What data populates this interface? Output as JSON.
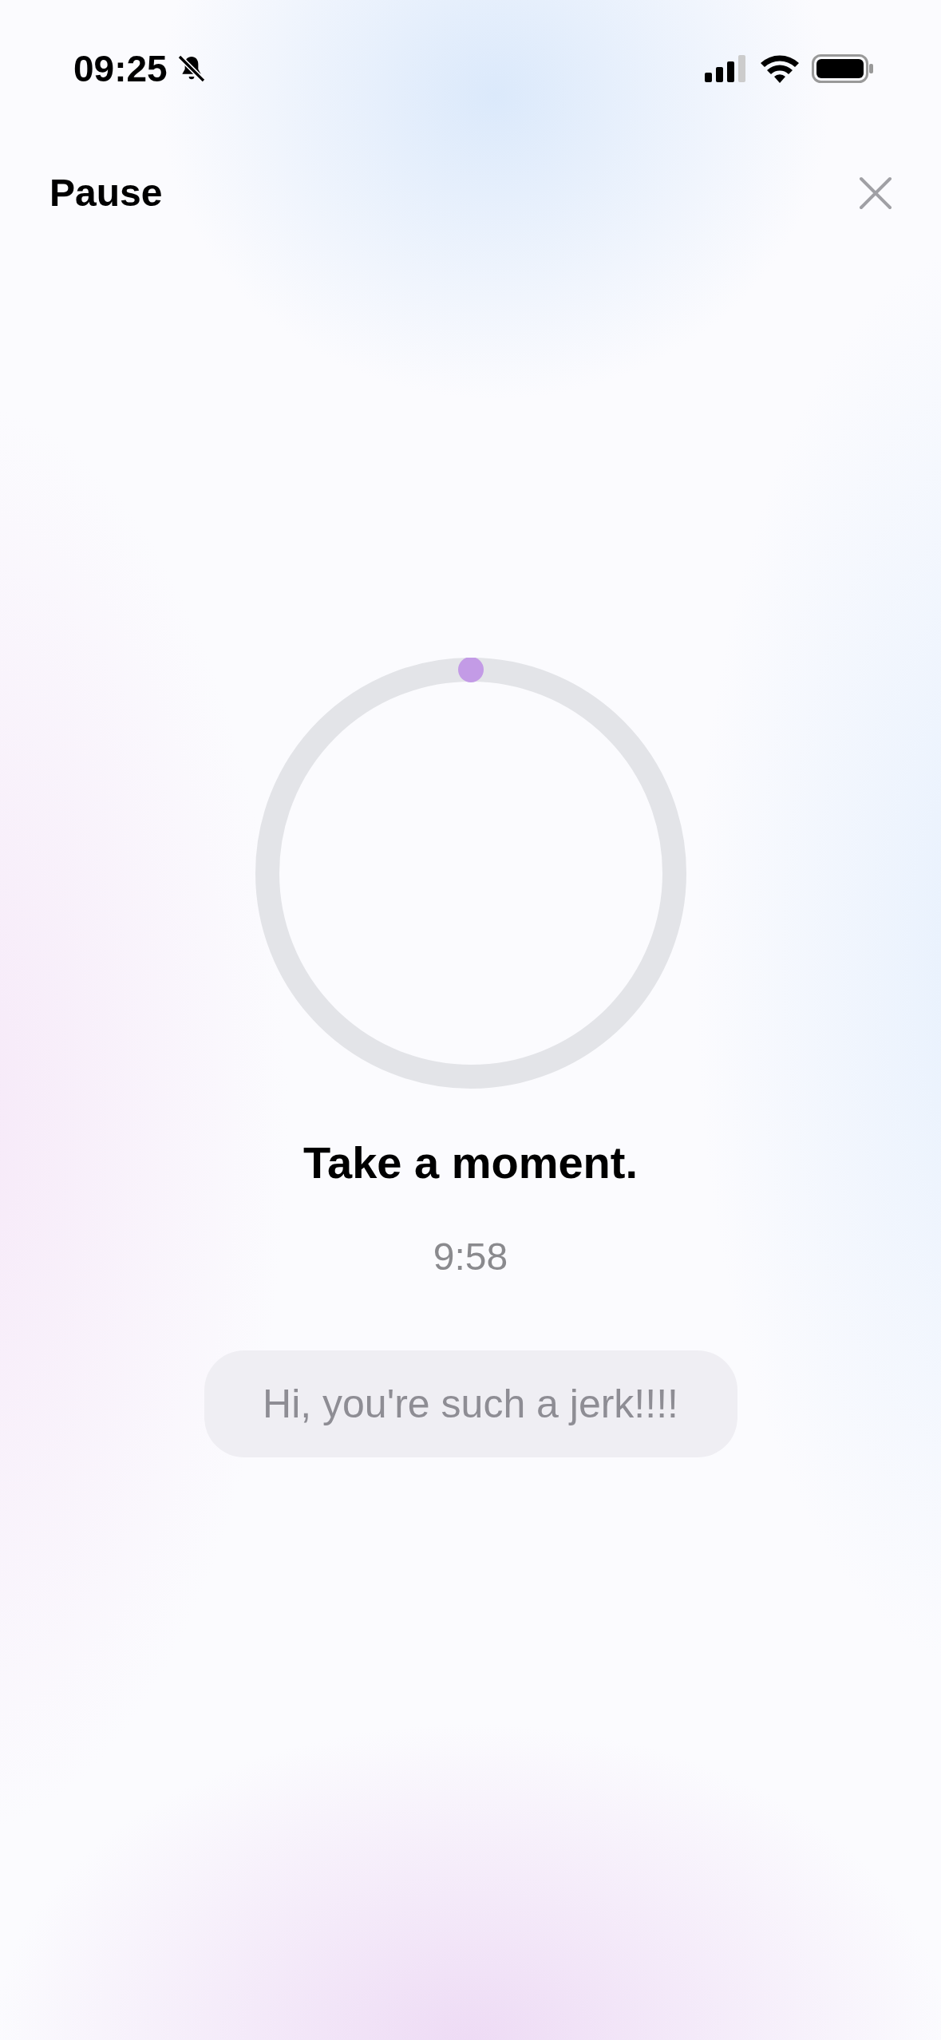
{
  "status_bar": {
    "time": "09:25"
  },
  "header": {
    "title": "Pause"
  },
  "timer": {
    "heading": "Take a moment.",
    "remaining": "9:58"
  },
  "message": {
    "text": "Hi, you're such a jerk!!!!"
  }
}
